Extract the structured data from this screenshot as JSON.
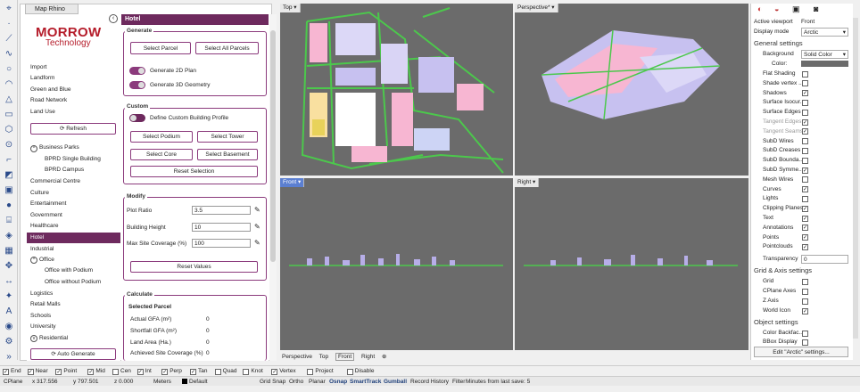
{
  "plugin": {
    "tab": "Map Rhino Plugin",
    "logo_line1": "MORROW",
    "logo_line2": "Technology"
  },
  "nav": {
    "items": [
      "Import",
      "Landform",
      "Green and Blue",
      "Road Network",
      "Land Use"
    ],
    "refresh": "⟳ Refresh",
    "business": "Business Parks",
    "business_sub": [
      "BPRD Single Building",
      "BPRD Campus"
    ],
    "items2": [
      "Commercial Centre",
      "Culture",
      "Entertainment",
      "Government",
      "Healthcare"
    ],
    "hotel": "Hotel",
    "industrial": "Industrial",
    "office": "Office",
    "office_sub": [
      "Office with Podium",
      "Office without Podium"
    ],
    "items3": [
      "Logistics",
      "Retail Malls",
      "Schools",
      "University"
    ],
    "residential": "Residential",
    "auto": "⟳ Auto Generate"
  },
  "hotel": {
    "title": "Hotel",
    "generate": {
      "title": "Generate",
      "select_parcel": "Select Parcel",
      "select_all": "Select All Parcels",
      "t1": "Generate 2D Plan",
      "t2": "Generate 3D Geometry"
    },
    "custom": {
      "title": "Custom",
      "define": "Define Custom Building Profile",
      "podium": "Select Podium",
      "tower": "Select Tower",
      "core": "Select Core",
      "basement": "Select Basement",
      "reset": "Reset Selection"
    },
    "modify": {
      "title": "Modify",
      "plot_label": "Plot Ratio",
      "plot_val": "3.5",
      "height_label": "Building Height",
      "height_val": "10",
      "site_label": "Max Site Coverage (%)",
      "site_val": "100",
      "reset": "Reset Values"
    },
    "calculate": {
      "title": "Calculate",
      "selected": "Selected Parcel",
      "rows": [
        [
          "Actual GFA (m²)",
          "0"
        ],
        [
          "Shortfall GFA (m²)",
          "0"
        ],
        [
          "Land Area (Ha.)",
          "0"
        ],
        [
          "Achieved Site Coverage (%)",
          "0"
        ]
      ]
    }
  },
  "viewports": {
    "top": "Top",
    "perspective": "Perspective*",
    "front": "Front",
    "right": "Right"
  },
  "vptabs": [
    "Perspective",
    "Top",
    "Front",
    "Right"
  ],
  "props": {
    "active_viewport_label": "Active viewport",
    "active_viewport": "Front",
    "display_mode_label": "Display mode",
    "display_mode": "Arctic",
    "general": "General settings",
    "background_label": "Background",
    "background": "Solid Color",
    "color_label": "Color:",
    "checks": [
      [
        "Flat Shading",
        false
      ],
      [
        "Shade vertex ...",
        false
      ],
      [
        "Shadows",
        true
      ],
      [
        "Surface Isocur...",
        false
      ],
      [
        "Surface Edges",
        false
      ],
      [
        "Tangent Edges",
        true
      ],
      [
        "Tangent Seams",
        true
      ],
      [
        "SubD Wires",
        false
      ],
      [
        "SubD Creases",
        false
      ],
      [
        "SubD Bounda...",
        false
      ],
      [
        "SubD Symme...",
        true
      ],
      [
        "Mesh Wires",
        false
      ],
      [
        "Curves",
        true
      ],
      [
        "Lights",
        false
      ],
      [
        "Clipping Planes",
        true
      ],
      [
        "Text",
        true
      ],
      [
        "Annotations",
        true
      ],
      [
        "Points",
        true
      ],
      [
        "Pointclouds",
        true
      ]
    ],
    "transparency_label": "Transparency",
    "transparency": "0",
    "grid_axis": "Grid & Axis settings",
    "grid_checks": [
      [
        "Grid",
        false
      ],
      [
        "CPlane Axes",
        false
      ],
      [
        "Z Axis",
        false
      ],
      [
        "World Icon",
        true
      ]
    ],
    "object": "Object settings",
    "obj_checks": [
      [
        "Color Backfac...",
        false
      ],
      [
        "BBox Display",
        false
      ]
    ],
    "edit": "Edit \"Arctic\" settings..."
  },
  "osnap": [
    "End",
    "Near",
    "Point",
    "Mid",
    "Cen",
    "Int",
    "Perp",
    "Tan",
    "Quad",
    "Knot",
    "Vertex",
    "Project",
    "Disable"
  ],
  "osnap_checked": [
    true,
    true,
    true,
    true,
    false,
    true,
    true,
    true,
    false,
    false,
    true,
    false,
    false
  ],
  "status": {
    "cplane": "CPlane",
    "x": "x 317.556",
    "y": "y 797.501",
    "z": "z 0.000",
    "units": "Meters",
    "layer": "Default",
    "toggles": [
      "Grid Snap",
      "Ortho",
      "Planar",
      "Osnap",
      "SmartTrack",
      "Gumball",
      "Record History",
      "Filter"
    ],
    "msg": "Minutes from last save: 5"
  },
  "colors": {
    "accent": "#6e2a5e",
    "brand": "#b51c2a"
  }
}
